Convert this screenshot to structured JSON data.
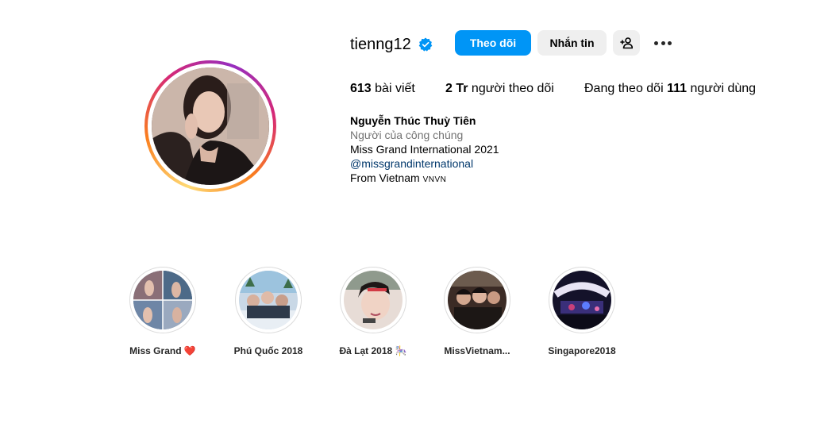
{
  "profile": {
    "username": "tienng12",
    "verified": true,
    "follow_label": "Theo dõi",
    "message_label": "Nhắn tin",
    "accent_color": "#0095f6"
  },
  "stats": {
    "posts_count": "613",
    "posts_label": "bài viết",
    "followers_count": "2 Tr",
    "followers_label": "người theo dõi",
    "following_prefix": "Đang theo dõi",
    "following_count": "111",
    "following_label": "người dùng"
  },
  "bio": {
    "full_name": "Nguyễn Thúc Thuỳ Tiên",
    "category": "Người của công chúng",
    "line1": "Miss Grand International 2021",
    "mention": "@missgrandinternational",
    "line2_text": "From Vietnam",
    "line2_flag": "VNVN"
  },
  "highlights": [
    {
      "label": "Miss Grand",
      "emoji": "❤️"
    },
    {
      "label": "Phú Quốc 2018",
      "emoji": ""
    },
    {
      "label": "Đà Lạt 2018",
      "emoji": "🎠"
    },
    {
      "label": "MissVietnam...",
      "emoji": ""
    },
    {
      "label": "Singapore2018",
      "emoji": ""
    }
  ],
  "icons": {
    "verified": "verified-badge-icon",
    "add_user": "add-user-icon",
    "more": "more-options-icon"
  }
}
